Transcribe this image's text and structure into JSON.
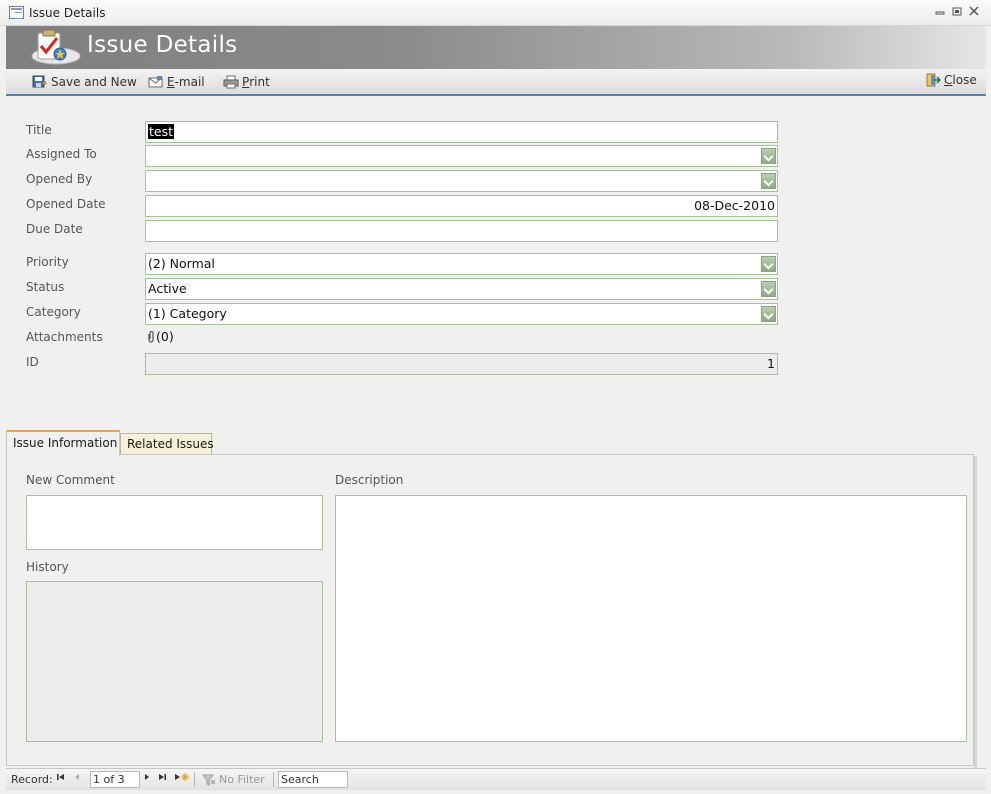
{
  "window": {
    "title": "Issue Details",
    "minimize": "▭",
    "restore": "◫",
    "close": "✕"
  },
  "header": {
    "title": "Issue Details",
    "logo_icon": "clipboard-checkmark-icon"
  },
  "toolbar": {
    "save_and_new_label": "Save and New",
    "email_label_u": "E",
    "email_label_rest": "-mail",
    "print_label_u": "P",
    "print_label_rest": "rint",
    "close_label_u": "C",
    "close_label_rest": "lose"
  },
  "form": {
    "title_label": "Title",
    "title_value": "test",
    "assigned_to_label": "Assigned To",
    "assigned_to_value": "",
    "opened_by_label": "Opened By",
    "opened_by_value": "",
    "opened_date_label": "Opened Date",
    "opened_date_value": "08-Dec-2010",
    "due_date_label": "Due Date",
    "due_date_value": "",
    "priority_label": "Priority",
    "priority_value": "(2) Normal",
    "status_label": "Status",
    "status_value": "Active",
    "category_label": "Category",
    "category_value": "(1) Category",
    "attachments_label": "Attachments",
    "attachments_value": "(0)",
    "id_label": "ID",
    "id_value": "1"
  },
  "tabs": [
    {
      "label": "Issue Information",
      "active": true
    },
    {
      "label": "Related Issues",
      "active": false
    }
  ],
  "panel": {
    "new_comment_label": "New Comment",
    "history_label": "History",
    "description_label": "Description"
  },
  "statusbar": {
    "record_label": "Record:",
    "record_value": "1 of 3",
    "no_filter_label": "No Filter",
    "search_placeholder": "Search"
  },
  "colors": {
    "field_border": "#a7c29a",
    "toolbar_accent": "#5b7fa6",
    "active_tab_accent": "#e8a25b"
  }
}
